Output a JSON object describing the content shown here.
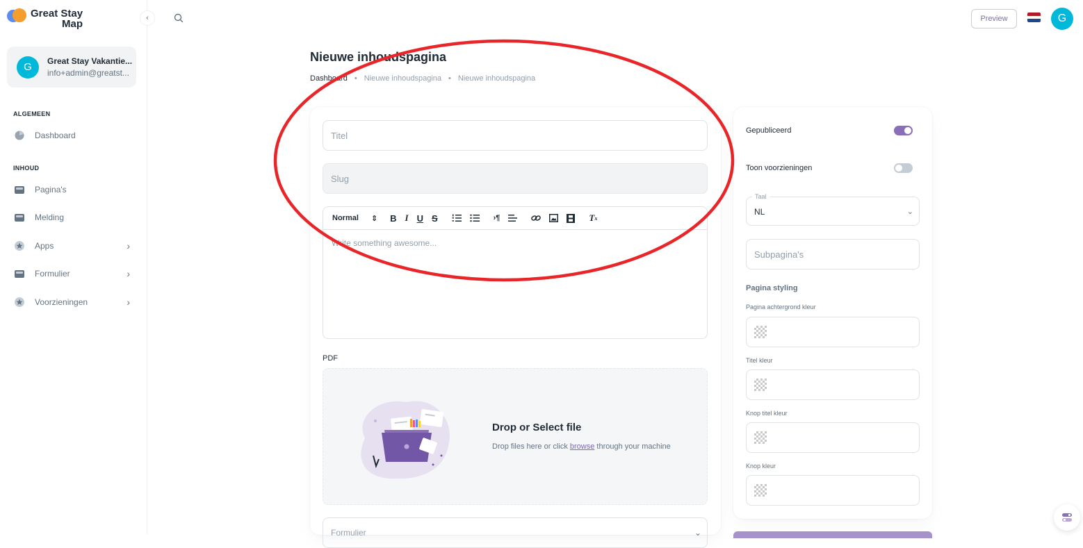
{
  "app": {
    "logo_line1": "Great Stay",
    "logo_line2": "Map"
  },
  "account": {
    "avatar_letter": "G",
    "name": "Great Stay Vakantie...",
    "email": "info+admin@greatst..."
  },
  "sidebar": {
    "sections": [
      {
        "title": "ALGEMEEN"
      },
      {
        "title": "INHOUD"
      }
    ],
    "items": [
      {
        "label": "Dashboard",
        "icon": "dashboard-icon"
      },
      {
        "label": "Pagina's",
        "icon": "folder-icon"
      },
      {
        "label": "Melding",
        "icon": "folder-icon"
      },
      {
        "label": "Apps",
        "icon": "star-icon"
      },
      {
        "label": "Formulier",
        "icon": "folder-icon"
      },
      {
        "label": "Voorzieningen",
        "icon": "star-icon"
      }
    ]
  },
  "topbar": {
    "preview_label": "Preview",
    "avatar_letter": "G",
    "language_flag": "nl-flag-icon"
  },
  "header": {
    "title": "Nieuwe inhoudspagina",
    "breadcrumb": [
      "Dashboard",
      "Nieuwe inhoudspagina",
      "Nieuwe inhoudspagina"
    ]
  },
  "form": {
    "title_placeholder": "Titel",
    "slug_placeholder": "Slug",
    "editor": {
      "format_label": "Normal",
      "placeholder": "Write something awesome..."
    },
    "pdf_label": "PDF",
    "dropzone": {
      "title": "Drop or Select file",
      "text_before": "Drop files here or click ",
      "link": "browse",
      "text_after": " through your machine"
    },
    "formulier_placeholder": "Formulier"
  },
  "side": {
    "published_label": "Gepubliceerd",
    "published_on": true,
    "facilities_label": "Toon voorzieningen",
    "facilities_on": false,
    "language_legend": "Taal",
    "language_value": "NL",
    "subpages_placeholder": "Subpagina's",
    "styling_heading": "Pagina styling",
    "color_fields": [
      {
        "label": "Pagina achtergrond kleur"
      },
      {
        "label": "Titel kleur"
      },
      {
        "label": "Knop titel kleur"
      },
      {
        "label": "Knop kleur"
      }
    ]
  },
  "colors": {
    "accent": "#8a6fb8",
    "cyan_avatar": "#00b8d9",
    "annotation_red": "#e8262a"
  }
}
